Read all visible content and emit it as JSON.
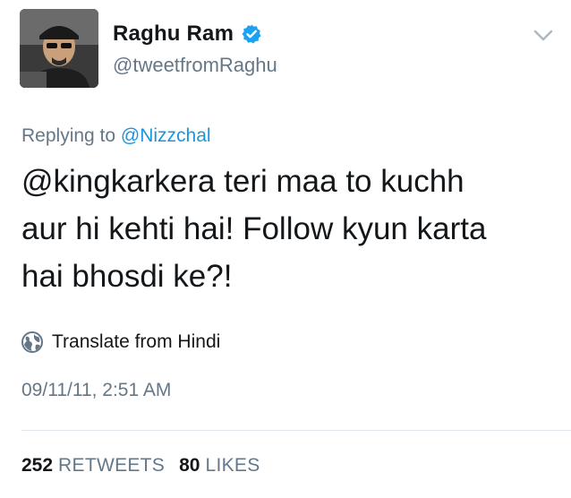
{
  "author": {
    "display_name": "Raghu Ram",
    "handle": "@tweetfromRaghu",
    "verified": true,
    "verified_color": "#1da1f2"
  },
  "reply": {
    "prefix": "Replying to ",
    "target": "@Nizzchal"
  },
  "tweet": {
    "line1": "@kingkarkera teri maa to kuchh",
    "line2": "aur hi kehti hai! Follow kyun karta",
    "line3": "hai bhosdi ke?!"
  },
  "translate": {
    "icon": "globe-icon",
    "label": "Translate from Hindi"
  },
  "timestamp": "09/11/11, 2:51 AM",
  "stats": {
    "retweets_count": "252",
    "retweets_label": "RETWEETS",
    "likes_count": "80",
    "likes_label": "LIKES"
  },
  "colors": {
    "text": "#14171a",
    "secondary": "#657786",
    "link": "#1b95e0",
    "divider": "#e1e8ed"
  }
}
